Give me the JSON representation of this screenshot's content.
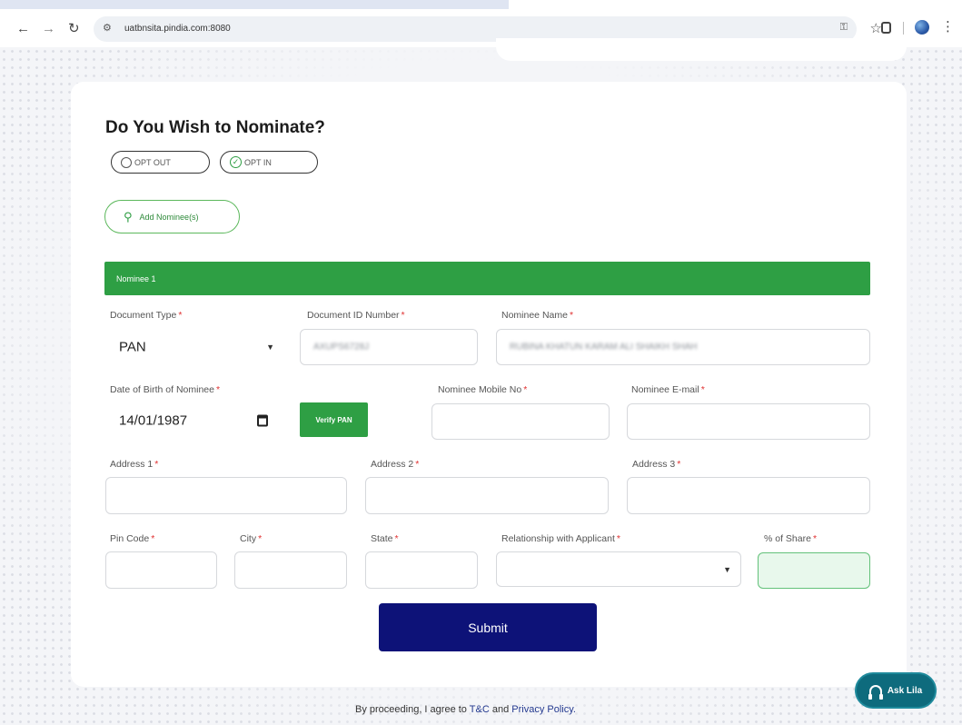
{
  "browser": {
    "url": "uatbnsita.pindia.com:8080",
    "back_icon": "←",
    "forward_icon": "→",
    "reload_icon": "↻"
  },
  "form": {
    "title": "Do You Wish to Nominate?",
    "opt_out_label": "OPT OUT",
    "opt_in_label": "OPT IN",
    "selected_option": "OPT IN",
    "add_nominee_label": "Add Nominee(s)",
    "nominee_header": "Nominee 1",
    "fields": {
      "document_type": {
        "label": "Document Type",
        "value": "PAN"
      },
      "document_id": {
        "label": "Document ID Number",
        "value": "AXUPS6728J"
      },
      "nominee_name": {
        "label": "Nominee Name",
        "value": "RUBINA KHATUN KARAM ALI SHAIKH SHAH"
      },
      "dob": {
        "label": "Date of Birth of Nominee",
        "value": "14/01/1987"
      },
      "verify_pan_label": "Verify PAN",
      "mobile": {
        "label": "Nominee Mobile No",
        "value": ""
      },
      "email": {
        "label": "Nominee E-mail",
        "value": ""
      },
      "address1": {
        "label": "Address 1",
        "value": ""
      },
      "address2": {
        "label": "Address 2",
        "value": ""
      },
      "address3": {
        "label": "Address 3",
        "value": ""
      },
      "pin_code": {
        "label": "Pin Code",
        "value": ""
      },
      "city": {
        "label": "City",
        "value": ""
      },
      "state": {
        "label": "State",
        "value": ""
      },
      "relationship": {
        "label": "Relationship with Applicant",
        "value": ""
      },
      "share": {
        "label": "% of Share",
        "value": ""
      }
    },
    "required_marker": "*",
    "submit_label": "Submit"
  },
  "footer": {
    "prefix": "By proceeding, I agree to",
    "tnc": "T&C",
    "and": "and",
    "privacy": "Privacy Policy."
  },
  "ask_button_label": "Ask Lila",
  "colors": {
    "accent_green": "#2e9f44",
    "submit_navy": "#0d1278",
    "ask_teal": "#0e6b7d"
  }
}
